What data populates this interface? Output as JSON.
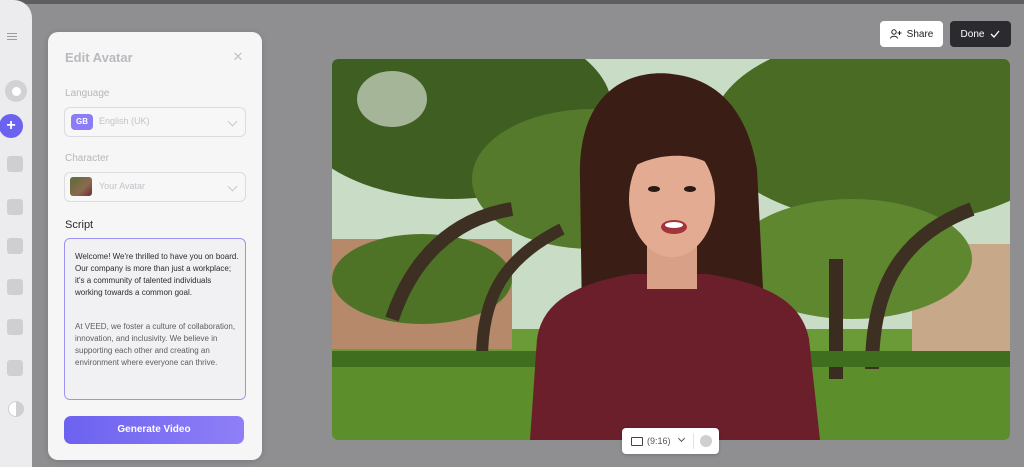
{
  "panel": {
    "title": "Edit Avatar",
    "close_icon": "close-icon",
    "language": {
      "label": "Language",
      "badge": "GB",
      "value": "English (UK)"
    },
    "character": {
      "label": "Character",
      "value": "Your Avatar"
    },
    "script": {
      "label": "Script",
      "paragraph1": "Welcome! We're thrilled to have you on board. Our company is more than just a workplace; it's a community of talented individuals working towards a common goal.",
      "paragraph2": "At VEED, we foster a culture of collaboration, innovation, and inclusivity. We believe in supporting each other and creating an environment where everyone can thrive."
    },
    "generate_label": "Generate Video"
  },
  "header": {
    "share_label": "Share",
    "done_label": "Done"
  },
  "preview": {
    "aspect_ratio": "(9:16)"
  },
  "colors": {
    "accent": "#7a6ff3",
    "done_bg": "#2b2b2f"
  },
  "sidebar_icons": [
    "menu-icon",
    "record-icon",
    "add-icon",
    "music-icon",
    "subtitles-icon",
    "text-icon",
    "elements-icon",
    "record-video-icon",
    "player-icon",
    "filter-icon"
  ]
}
